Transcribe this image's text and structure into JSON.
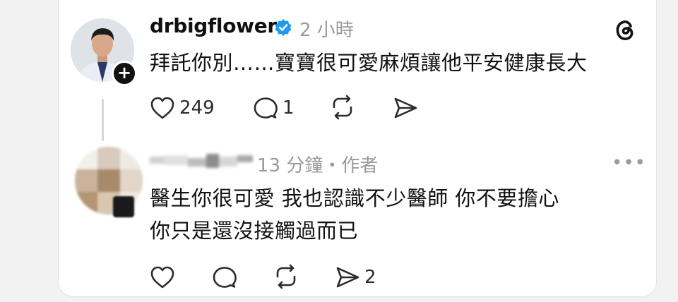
{
  "post": {
    "username": "drbigflower",
    "time": "2 小時",
    "text": "拜託你別……寶寶很可愛麻煩讓他平安健康長大",
    "likes": "249",
    "replies": "1"
  },
  "reply": {
    "time_author": "13 分鐘・作者",
    "more": "•••",
    "text_line1": "醫生你很可愛 我也認識不少醫師 你不要擔心",
    "text_line2": "你只是還沒接觸過而已",
    "shares": "2"
  },
  "colors": {
    "text": "#111111",
    "muted": "#9a9a9a",
    "verified": "#1d9bf0"
  }
}
